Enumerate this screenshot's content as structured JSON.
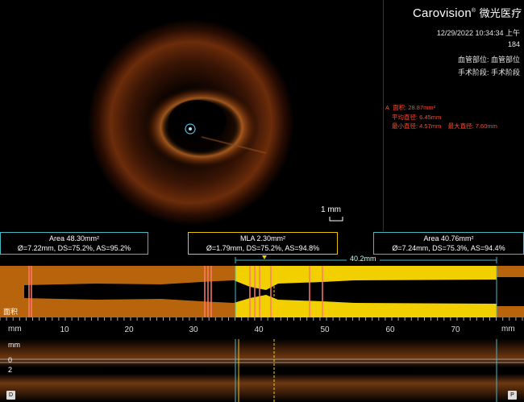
{
  "brand": {
    "name": "Carovision",
    "registered": "®",
    "cn_name": "微光医疗"
  },
  "info": {
    "datetime": "12/29/2022 10:34:34 上午",
    "frame": "184",
    "vessel": "血管部位: 血管部位",
    "stage": "手术阶段: 手术阶段"
  },
  "measurement": {
    "label": "A",
    "area": "面积: 28.87mm²",
    "mean_diameter": "平均直径: 6.45mm",
    "min_diameter": "最小直径: 4.57mm",
    "max_diameter": "最大直径: 7.60mm"
  },
  "scale_bar": {
    "label": "1 mm"
  },
  "boxes": {
    "left": {
      "title": "Area 48.30mm²",
      "detail": "Ø=7.22mm, DS=75.2%, AS=95.2%"
    },
    "mla": {
      "title": "MLA 2.30mm²",
      "detail": "Ø=1.79mm, DS=75.2%, AS=94.8%"
    },
    "right": {
      "title": "Area 40.76mm²",
      "detail": "Ø=7.24mm, DS=75.3%, AS=94.4%"
    }
  },
  "length_label": "40.2mm",
  "long_view_label": "面积",
  "axis": {
    "unit_left": "mm",
    "unit_right": "mm",
    "ticks": [
      "10",
      "20",
      "30",
      "40",
      "50",
      "60",
      "70"
    ]
  },
  "depth_labels": {
    "unit": "mm",
    "zero": "0",
    "two": "2"
  },
  "corner_left": "D",
  "corner_right": "P",
  "colors": {
    "accent_cyan": "#47b9c2",
    "mla_yellow": "#f2d000",
    "plot_orange": "#b8640c",
    "marker_red": "#ff4a2a"
  }
}
